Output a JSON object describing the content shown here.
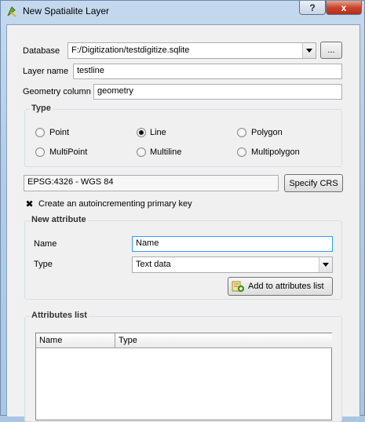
{
  "window": {
    "title": "New Spatialite Layer",
    "help_glyph": "?",
    "close_glyph": "x"
  },
  "form": {
    "database_label": "Database",
    "database_value": "F:/Digitization/testdigitize.sqlite",
    "browse_label": "...",
    "layer_name_label": "Layer name",
    "layer_name_value": "testline",
    "geometry_column_label": "Geometry column",
    "geometry_column_value": "geometry"
  },
  "type_group": {
    "title": "Type",
    "options": [
      "Point",
      "Line",
      "Polygon",
      "MultiPoint",
      "Multiline",
      "Multipolygon"
    ],
    "selected": "Line"
  },
  "crs": {
    "value": "EPSG:4326 - WGS 84",
    "button_label": "Specify CRS"
  },
  "primary_key": {
    "label": "Create an autoincrementing primary key",
    "checked": true
  },
  "new_attribute": {
    "title": "New attribute",
    "name_label": "Name",
    "name_value": "Name",
    "type_label": "Type",
    "type_value": "Text data",
    "add_button_label": "Add to attributes list"
  },
  "attributes_list": {
    "title": "Attributes list",
    "columns": [
      "Name",
      "Type"
    ],
    "rows": []
  },
  "colors": {
    "focus_border": "#3399ff",
    "close_red": "#c9452e"
  },
  "icons": {
    "app": "qgis-icon",
    "add": "add-to-list-icon"
  }
}
